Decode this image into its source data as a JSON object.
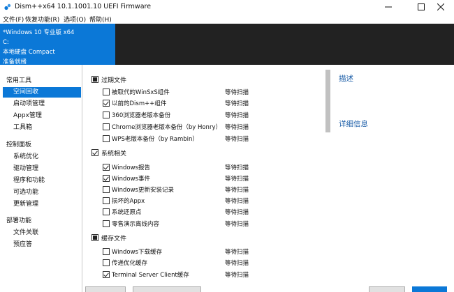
{
  "window": {
    "title": "Dism++x64 10.1.1001.10 UEFI Firmware"
  },
  "menu": [
    "文件(F)",
    "恢复功能(R)",
    "选项(O)",
    "帮助(H)"
  ],
  "system_info": {
    "name": "*Windows 10 专业版 x64",
    "drive": "C:",
    "disk": "本地硬盘 Compact",
    "status": "准备就绪"
  },
  "sidebar": {
    "groups": [
      {
        "label": "常用工具",
        "items": [
          "空间回收",
          "启动项管理",
          "Appx管理",
          "工具箱"
        ]
      },
      {
        "label": "控制面板",
        "items": [
          "系统优化",
          "驱动管理",
          "程序和功能",
          "可选功能",
          "更新管理"
        ]
      },
      {
        "label": "部署功能",
        "items": [
          "文件关联",
          "预应答"
        ]
      }
    ],
    "active_item": "空间回收"
  },
  "content": {
    "sections": [
      {
        "label": "过期文件",
        "state": "indeterminate",
        "items": [
          {
            "label": "被取代的WinSxS组件",
            "checked": false,
            "status": "等待扫描"
          },
          {
            "label": "以前的Dism++组件",
            "checked": true,
            "status": "等待扫描"
          },
          {
            "label": "360浏览器老版本备份",
            "checked": false,
            "status": "等待扫描"
          },
          {
            "label": "Chrome浏览器老版本备份（by Honry）",
            "checked": false,
            "status": "等待扫描"
          },
          {
            "label": "WPS老版本备份（by Rambin）",
            "checked": false,
            "status": "等待扫描"
          }
        ]
      },
      {
        "label": "系统相关",
        "state": "checked",
        "items": [
          {
            "label": "Windows报告",
            "checked": true,
            "status": "等待扫描"
          },
          {
            "label": "Windows事件",
            "checked": true,
            "status": "等待扫描"
          },
          {
            "label": "Windows更新安装记录",
            "checked": false,
            "status": "等待扫描"
          },
          {
            "label": "损坏的Appx",
            "checked": false,
            "status": "等待扫描"
          },
          {
            "label": "系统还原点",
            "checked": false,
            "status": "等待扫描"
          },
          {
            "label": "零售演示离线内容",
            "checked": false,
            "status": "等待扫描"
          }
        ]
      },
      {
        "label": "缓存文件",
        "state": "indeterminate",
        "items": [
          {
            "label": "Windows下载缓存",
            "checked": false,
            "status": "等待扫描"
          },
          {
            "label": "传递优化缓存",
            "checked": false,
            "status": "等待扫描"
          },
          {
            "label": "Terminal Server Client缓存",
            "checked": true,
            "status": "等待扫描"
          }
        ]
      }
    ],
    "scroll_position": 0
  },
  "right_panel": {
    "description_heading": "描述",
    "details_heading": "详细信息"
  },
  "colors": {
    "accent": "#0b78d7",
    "dark_band": "#222222",
    "link_heading": "#1c5ea8"
  },
  "icons": [
    "app-icon",
    "minimize-icon",
    "maximize-icon",
    "close-icon",
    "checkbox-icon"
  ]
}
